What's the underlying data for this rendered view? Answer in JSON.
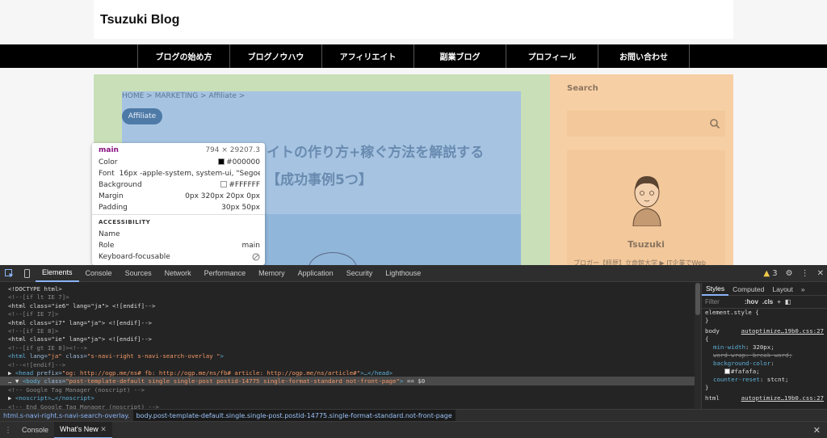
{
  "site": {
    "title": "Tsuzuki Blog",
    "nav": [
      "ブログの始め方",
      "ブログノウハウ",
      "アフィリエイト",
      "副業ブログ",
      "プロフィール",
      "お問い合わせ"
    ]
  },
  "article": {
    "breadcrumb": "HOME > MARKETING > Affiliate >",
    "category": "Affiliate",
    "title_line1": "イトの作り方+稼ぐ方法を解説する",
    "title_line2": "【成功事例5つ】"
  },
  "sidebar": {
    "search_label": "Search",
    "profile_name": "Tsuzuki",
    "profile_text": "ブロガー【経歴】立命館大学 ▶ IT企業でWeb"
  },
  "tooltip": {
    "tag": "main",
    "dimensions": "794 × 29207.3",
    "color_label": "Color",
    "color_value": "#000000",
    "font_label": "Font",
    "font_value": "16px -apple-system, system-ui, \"Segoe…",
    "background_label": "Background",
    "background_value": "#FFFFFF",
    "margin_label": "Margin",
    "margin_value": "0px 320px 20px 0px",
    "padding_label": "Padding",
    "padding_value": "30px 50px",
    "accessibility_label": "ACCESSIBILITY",
    "name_label": "Name",
    "role_label": "Role",
    "role_value": "main",
    "focusable_label": "Keyboard-focusable"
  },
  "devtools": {
    "tabs": [
      "Elements",
      "Console",
      "Sources",
      "Network",
      "Performance",
      "Memory",
      "Application",
      "Security",
      "Lighthouse"
    ],
    "active_tab": "Elements",
    "warning_count": "3",
    "styles_tabs": [
      "Styles",
      "Computed",
      "Layout"
    ],
    "filter_placeholder": "Filter",
    "hov": ":hov",
    "cls": ".cls",
    "drawer_tabs": [
      "Console",
      "What's New"
    ],
    "breadcrumbs": [
      "html.s-navi-right.s-navi-search-overlay.",
      "body.post-template-default.single.single-post.postid-14775.single-format-standard.not-front-page"
    ],
    "style_rules": {
      "element_style": "element.style {",
      "close": "}",
      "body_selector": "body",
      "body_source": "autoptimize…19b0.css:27",
      "open": "{",
      "min_width_prop": "min-width",
      "min_width_val": "320px;",
      "word_wrap_prop": "word-wrap",
      "word_wrap_val": "break-word;",
      "bg_prop": "background-color",
      "bg_val": "#fafafa;",
      "counter_prop": "counter-reset",
      "counter_val": "stcnt;",
      "html_selector": "html",
      "html_source": "autoptimize…19b0.css:27"
    }
  },
  "code_lines": [
    [
      {
        "c": "c-txt",
        "t": "<!DOCTYPE html>"
      }
    ],
    [
      {
        "c": "c-com",
        "t": "<!--[if lt IE 7]>"
      }
    ],
    [
      {
        "c": "c-txt",
        "t": "<html class=\"ie6\" lang=\"ja\"> <![endif]-->"
      }
    ],
    [
      {
        "c": "c-com",
        "t": "<!--[if IE 7]>"
      }
    ],
    [
      {
        "c": "c-txt",
        "t": "<html class=\"i7\" lang=\"ja\"> <![endif]-->"
      }
    ],
    [
      {
        "c": "c-com",
        "t": "<!--[if IE 8]>"
      }
    ],
    [
      {
        "c": "c-txt",
        "t": "<html class=\"ie\" lang=\"ja\"> <![endif]-->"
      }
    ],
    [
      {
        "c": "c-com",
        "t": "<!--[if gt IE 8]><!-->"
      }
    ],
    [
      {
        "c": "c-tag",
        "t": "<html "
      },
      {
        "c": "c-attr",
        "t": "lang="
      },
      {
        "c": "c-val",
        "t": "\"ja\" "
      },
      {
        "c": "c-attr",
        "t": "class="
      },
      {
        "c": "c-val",
        "t": "\"s-navi-right s-navi-search-overlay \""
      },
      {
        "c": "c-tag",
        "t": ">"
      }
    ],
    [
      {
        "c": "c-com",
        "t": "  <!--<![endif]-->"
      }
    ],
    [
      {
        "c": "c-txt",
        "t": "  ▶ "
      },
      {
        "c": "c-tag",
        "t": "<head "
      },
      {
        "c": "c-attr",
        "t": "prefix="
      },
      {
        "c": "c-val",
        "t": "\"og: http://ogp.me/ns# fb: http://ogp.me/ns/fb# article: http://ogp.me/ns/article#\""
      },
      {
        "c": "c-tag",
        "t": ">…</head>"
      }
    ],
    [
      {
        "c": "c-txt",
        "t": "… ▼ "
      },
      {
        "c": "c-tag",
        "t": "<body "
      },
      {
        "c": "c-attr",
        "t": "class="
      },
      {
        "c": "c-val",
        "t": "\"post-template-default single single-post postid-14775 single-format-standard not-front-page\""
      },
      {
        "c": "c-tag",
        "t": ">"
      },
      {
        "c": "c-txt",
        "t": " == $0"
      }
    ],
    [
      {
        "c": "c-com",
        "t": "      <!-- Google Tag Manager (noscript) -->"
      }
    ],
    [
      {
        "c": "c-txt",
        "t": "    ▶ "
      },
      {
        "c": "c-tag",
        "t": "<noscript>…</noscript>"
      }
    ],
    [
      {
        "c": "c-com",
        "t": "      <!-- End Google Tag Manager (noscript) -->"
      }
    ]
  ]
}
